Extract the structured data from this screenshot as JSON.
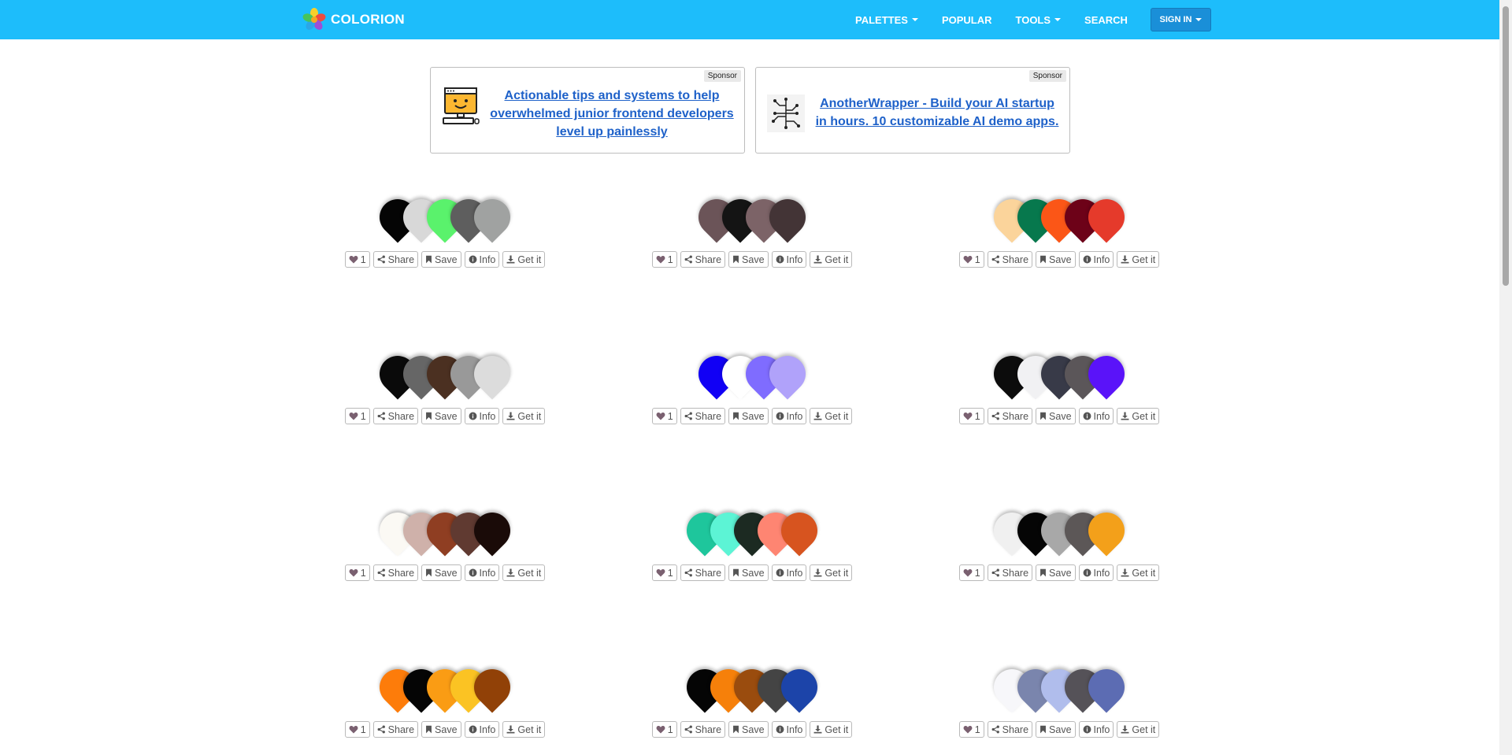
{
  "navbar": {
    "brand": "COLORION",
    "items": [
      {
        "label": "PALETTES",
        "dropdown": true
      },
      {
        "label": "POPULAR",
        "dropdown": false
      },
      {
        "label": "TOOLS",
        "dropdown": true
      },
      {
        "label": "SEARCH",
        "dropdown": false
      }
    ],
    "signin": "SIGN IN"
  },
  "sponsors": [
    {
      "tag": "Sponsor",
      "text": "Actionable tips and systems to help overwhelmed junior frontend developers level up painlessly",
      "icon": "computer-face-icon"
    },
    {
      "tag": "Sponsor",
      "text": "AnotherWrapper - Build your AI startup in hours. 10 customizable AI demo apps.",
      "icon": "circuit-icon"
    }
  ],
  "actions": {
    "likes": "1",
    "share": "Share",
    "save": "Save",
    "info": "Info",
    "get": "Get it"
  },
  "palettes": [
    [
      "#050505",
      "#d8d8d8",
      "#5af26c",
      "#5e5e5e",
      "#a0a2a1"
    ],
    [
      "#6b5458",
      "#141414",
      "#7c6367",
      "#433436"
    ],
    [
      "#fbd49b",
      "#07784d",
      "#fb5617",
      "#6d0218",
      "#e53a2b"
    ],
    [
      "#0a0a0a",
      "#666666",
      "#4b3021",
      "#999999",
      "#dcdcdc"
    ],
    [
      "#1100f5",
      "#ffffff",
      "#7f6cff",
      "#b0a2fa"
    ],
    [
      "#0c0c0c",
      "#f1f1f3",
      "#383a48",
      "#5b5659",
      "#5a13f9"
    ],
    [
      "#fbf9f4",
      "#cfb1aa",
      "#8f3e22",
      "#603a31",
      "#1a0b08"
    ],
    [
      "#1ec69c",
      "#5cf4d5",
      "#1c2a22",
      "#fe8572",
      "#d7541f"
    ],
    [
      "#f0f0f0",
      "#050505",
      "#a8a8a8",
      "#5c5757",
      "#f3a01a"
    ],
    [
      "#fd7c0a",
      "#050505",
      "#fa9c14",
      "#fbc323",
      "#914107"
    ],
    [
      "#050505",
      "#f6800a",
      "#9a4c0e",
      "#444444",
      "#1c44a9"
    ],
    [
      "#f7f7fa",
      "#7a85ad",
      "#b0bdec",
      "#555258",
      "#5c6cb3"
    ]
  ]
}
